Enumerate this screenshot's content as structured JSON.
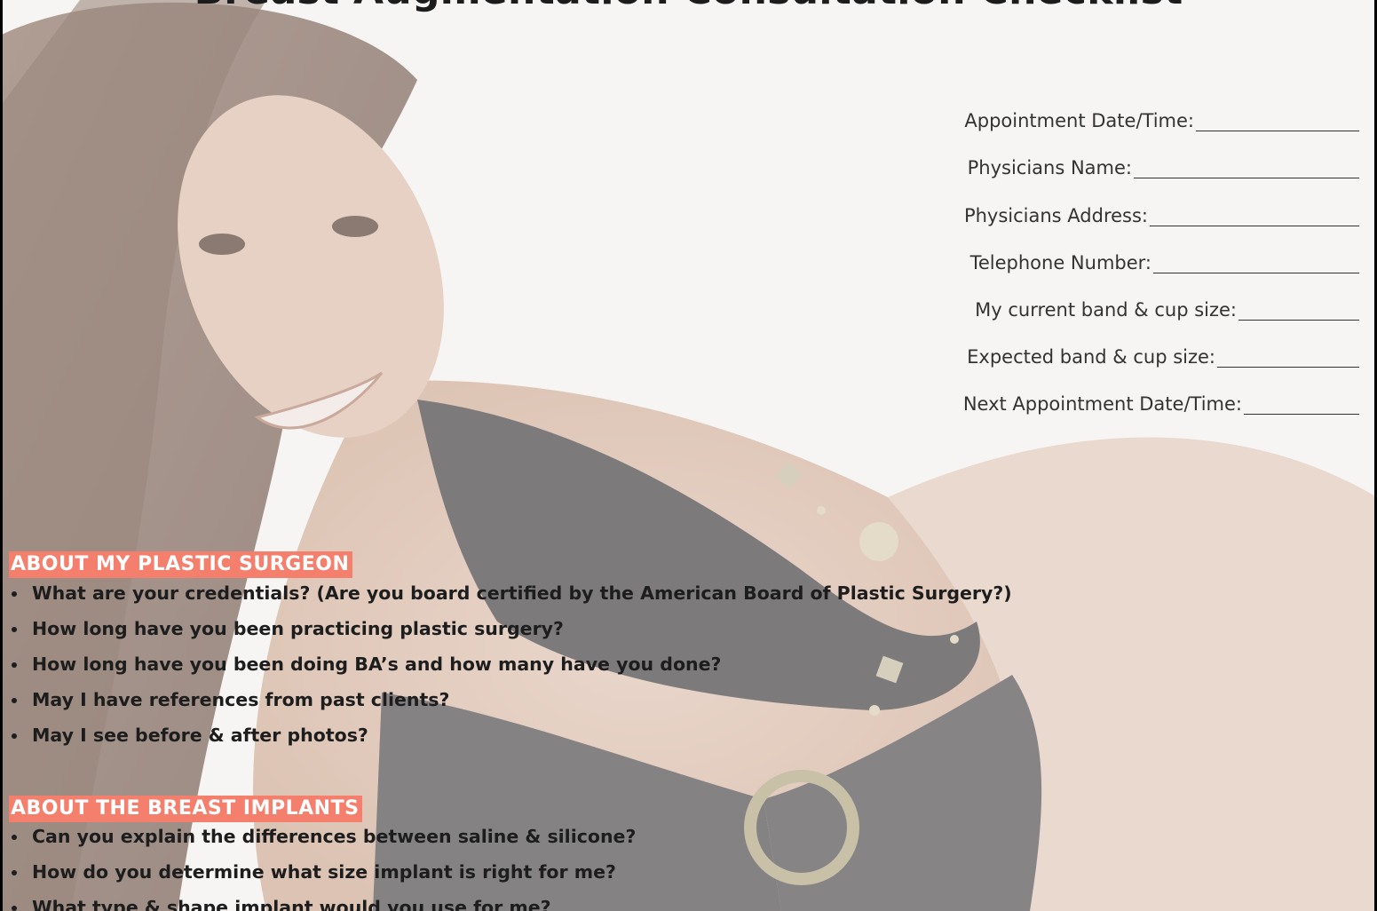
{
  "title": "Breast Augmentation Consultation Checklist",
  "form_fields": [
    {
      "label": "Appointment Date/Time:"
    },
    {
      "label": "Physicians Name:"
    },
    {
      "label": "Physicians Address:"
    },
    {
      "label": "Telephone Number: "
    },
    {
      "label": "My current band & cup size: "
    },
    {
      "label": "Expected band & cup size: "
    },
    {
      "label": "Next Appointment Date/Time:"
    }
  ],
  "sections": [
    {
      "heading": "ABOUT MY PLASTIC SURGEON",
      "questions": [
        "What are your credentials? (Are you board certified by the American Board of Plastic Surgery?)",
        "How long have you been practicing plastic surgery?",
        "How long have you been doing BA’s and how many have you done?",
        "May I have references from past clients?",
        "May I see before & after photos?"
      ]
    },
    {
      "heading": "ABOUT THE BREAST IMPLANTS",
      "questions": [
        "Can you explain the differences between saline & silicone?",
        "How do you determine what size implant is right for me?",
        "What type & shape implant would you use for me?"
      ]
    }
  ],
  "colors": {
    "section_heading_bg": "#f47f6d",
    "text": "#1d1d1d",
    "frame": "#000000"
  }
}
